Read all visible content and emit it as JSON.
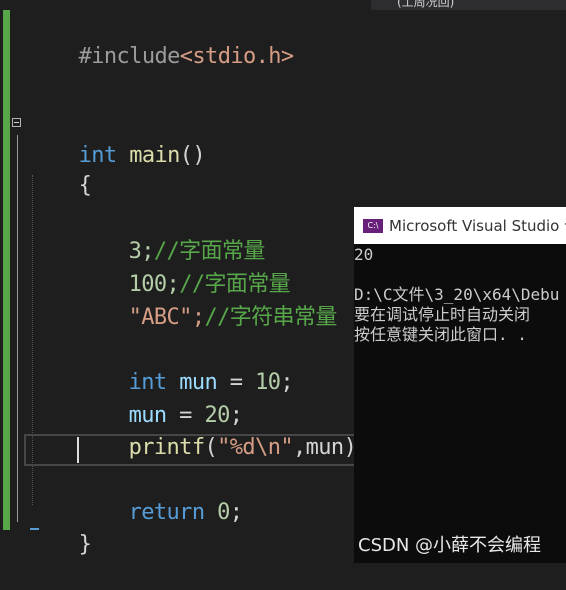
{
  "top_tab_hint": "(工周况回)",
  "editor": {
    "include_kw": "#include",
    "include_file": "<stdio.h>",
    "main_type": "int",
    "main_name": "main",
    "main_parens": "()",
    "open_brace": "{",
    "lines": [
      {
        "code": "3;",
        "comment": "//字面常量"
      },
      {
        "code": "100;",
        "comment": "//字面常量"
      },
      {
        "code": "\"ABC\";",
        "comment": "//字符串常量"
      }
    ],
    "decl_type": "int",
    "decl_var": "mun",
    "decl_eq": " = ",
    "decl_val": "10",
    "decl_end": ";",
    "assign_var": "mun",
    "assign_eq": " = ",
    "assign_val": "20",
    "assign_end": ";",
    "printf_fn": "printf",
    "printf_open": "(",
    "printf_str": "\"%d\\n\"",
    "printf_rest": ",mun);",
    "return_kw": "return",
    "return_val": "0",
    "return_end": ";",
    "close_brace": "}"
  },
  "console": {
    "title": "Microsoft Visual Studio 调",
    "icon_label": "C:\\",
    "output": "20",
    "path_line": "D:\\C文件\\3_20\\x64\\Debu",
    "msg_line1": "要在调试停止时自动关闭",
    "msg_line2": "按任意键关闭此窗口. ."
  },
  "watermark": "CSDN @小薛不会编程"
}
